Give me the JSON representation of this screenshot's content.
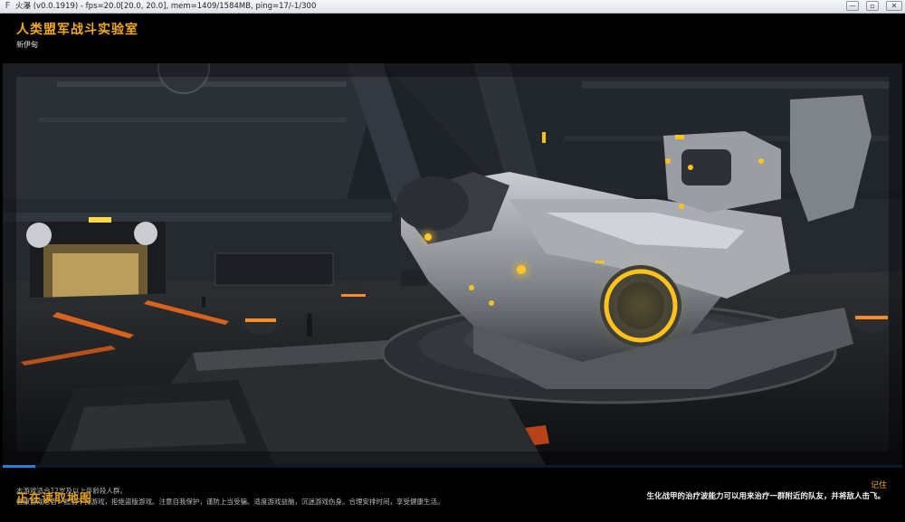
{
  "window": {
    "icon": "app-logo-icon",
    "title": "火瀑 (v0.0.1919) - fps=20.0[20.0, 20.0], mem=1409/1584MB, ping=17/-1/300",
    "minimize_glyph": "—",
    "restore_glyph": "▫",
    "close_glyph": "✕"
  },
  "header": {
    "map_title": "人类盟军战斗实验室",
    "map_subtitle": "新伊甸"
  },
  "loading": {
    "progress": 0.036,
    "accent_color": "#2a7fd4",
    "status": "正在读取地图",
    "age_notice": "本游戏适合12岁及以上年龄段人群。",
    "health_notice": "健康游戏忠告：抵制不良游戏，拒绝盗版游戏。注意自我保护，谨防上当受骗。适度游戏益脑，沉迷游戏伤身。合理安排时间，享受健康生活。"
  },
  "tip": {
    "title": "记住",
    "text": "生化战甲的治疗波能力可以用来治疗一群附近的队友，并将敌人击飞。"
  },
  "colors": {
    "accent_orange": "#f2a91c",
    "glow_yellow": "#ffc21a"
  }
}
